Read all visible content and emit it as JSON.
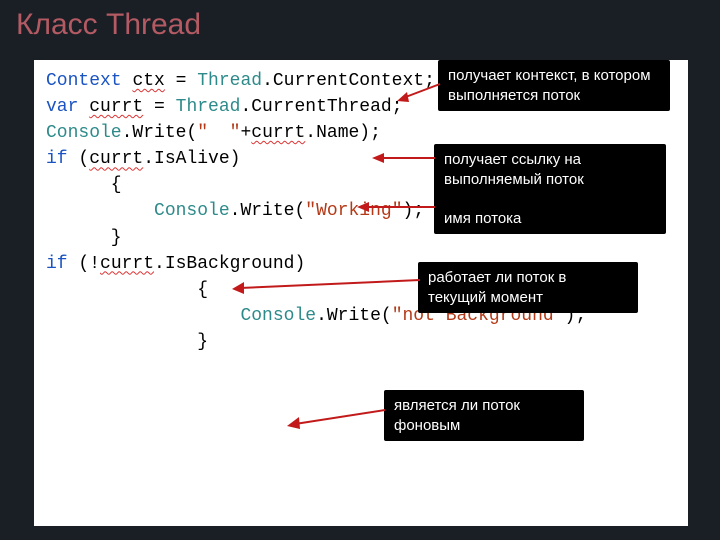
{
  "title": "Класс Thread",
  "code": {
    "l1_a": "Context",
    "l1_b": " ",
    "l1_c": "ctx",
    "l1_d": " = ",
    "l1_e": "Thread",
    "l1_f": ".CurrentContext;",
    "l2": "",
    "l3": "",
    "l4_a": "var",
    "l4_b": " ",
    "l4_c": "currt",
    "l4_d": " = ",
    "l4_e": "Thread",
    "l4_f": ".CurrentThread;",
    "l5": "",
    "l6_a": "Console",
    "l6_b": ".Write(",
    "l6_c": "\"  \"",
    "l6_d": "+",
    "l6_e": "currt",
    "l6_f": ".Name);",
    "l7": "",
    "l8": "",
    "l9_a": "if",
    "l9_b": " (",
    "l9_c": "currt",
    "l9_d": ".IsAlive)",
    "l10": "      {",
    "l11_a": "          ",
    "l11_b": "Console",
    "l11_c": ".Write(",
    "l11_d": "\"Working\"",
    "l11_e": ");",
    "l12": "      }",
    "l13": "",
    "l14_a": "if",
    "l14_b": " (!",
    "l14_c": "currt",
    "l14_d": ".IsBackground)",
    "l15": "              {",
    "l16_a": "                  ",
    "l16_b": "Console",
    "l16_c": ".Write(",
    "l16_d": "\"not Background\"",
    "l16_e": ");",
    "l17": "              }"
  },
  "callouts": {
    "c1": "получает контекст, в котором выполняется поток",
    "c2": "получает ссылку на выполняемый поток\n\nимя потока",
    "c3": "работает ли поток в текущий момент",
    "c4": "является ли поток фоновым"
  }
}
